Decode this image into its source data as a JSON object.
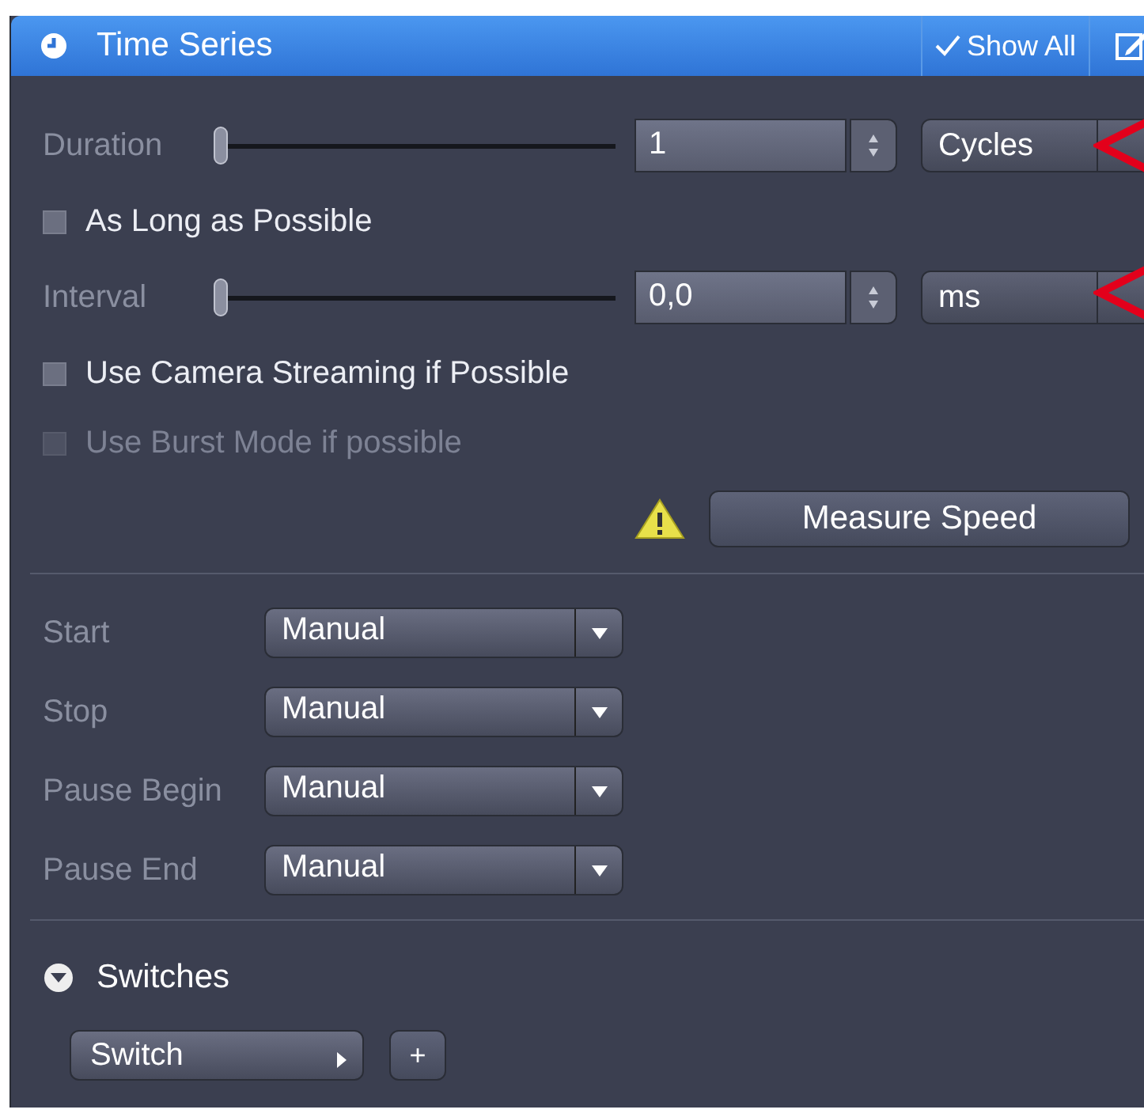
{
  "panel": {
    "title": "Time Series",
    "show_all": {
      "label": "Show All",
      "checked": true
    }
  },
  "timing": [
    {
      "label": "Duration",
      "level": 0,
      "value": "1",
      "unit": "Cycles"
    },
    {
      "label": "Interval",
      "level": 0,
      "value": "0,0",
      "unit": "ms"
    }
  ],
  "options": [
    {
      "label": "As Long as Possible",
      "checked": false,
      "disabled": false
    },
    {
      "label": "Use Camera Streaming if Possible",
      "checked": false,
      "disabled": false
    },
    {
      "label": "Use Burst Mode if possible",
      "checked": false,
      "disabled": true
    }
  ],
  "measure_button": "Measure Speed",
  "triggers": [
    {
      "label": "Start",
      "value": "Manual"
    },
    {
      "label": "Stop",
      "value": "Manual"
    },
    {
      "label": "Pause Begin",
      "value": "Manual"
    },
    {
      "label": "Pause End",
      "value": "Manual"
    }
  ],
  "switches": {
    "title": "Switches",
    "expanded": true,
    "button": "Switch",
    "add": "+"
  }
}
